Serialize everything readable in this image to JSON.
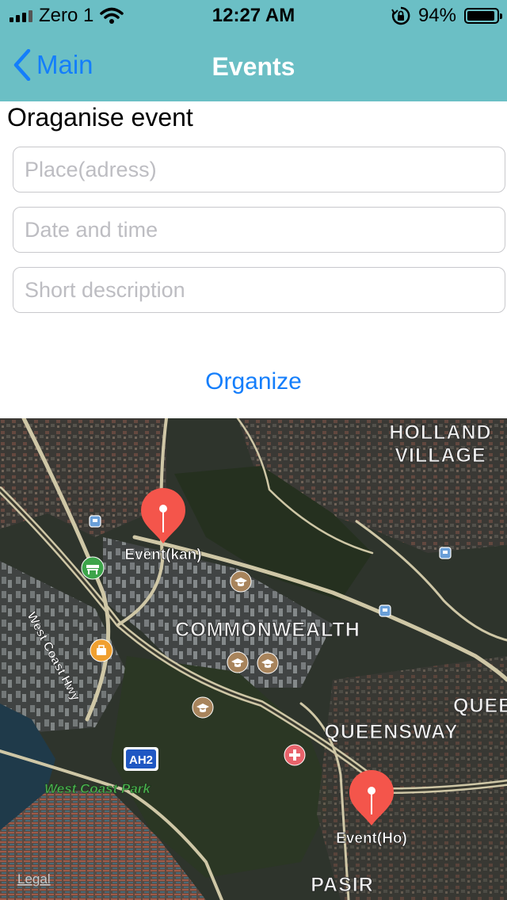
{
  "status_bar": {
    "carrier": "Zero 1",
    "time": "12:27 AM",
    "battery_percent": "94%",
    "battery_level": 0.94
  },
  "nav": {
    "back_label": "Main",
    "title": "Events"
  },
  "form": {
    "section_title": "Oraganise event",
    "place_placeholder": "Place(adress)",
    "place_value": "",
    "datetime_placeholder": "Date and time",
    "datetime_value": "",
    "description_placeholder": "Short description",
    "description_value": "",
    "organize_label": "Organize"
  },
  "map": {
    "labels": {
      "holland_line1": "HOLLAND",
      "holland_line2": "VILLAGE",
      "commonwealth": "COMMONWEALTH",
      "queensway": "QUEENSWAY",
      "quee": "QUEE",
      "west_coast_hwy": "West Coast Hwy",
      "west_coast_park": "West Coast Park",
      "route_badge": "AH2",
      "pasir": "PASIR",
      "legal": "Legal"
    },
    "pins": [
      {
        "label": "Event(kan)"
      },
      {
        "label": "Event(Ho)"
      }
    ],
    "pin_color": "#f4554b",
    "poi_icons": [
      "school-icon",
      "hospital-icon",
      "shopping-icon",
      "park-icon",
      "train-icon"
    ]
  }
}
